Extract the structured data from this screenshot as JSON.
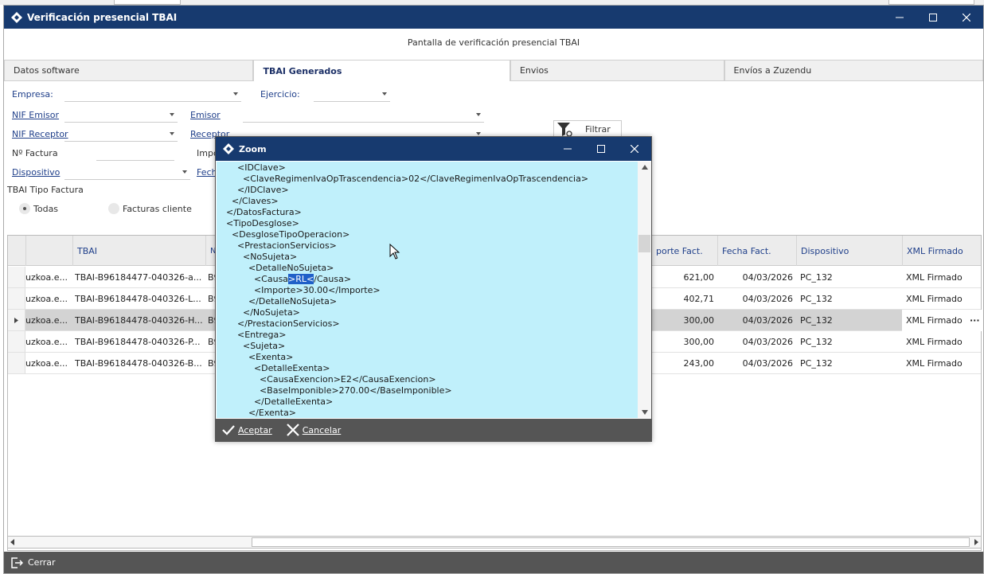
{
  "window": {
    "title": "Verificación presencial TBAI",
    "screen_title": "Pantalla de verificación presencial TBAI"
  },
  "tabs": [
    "Datos software",
    "TBAI Generados",
    "Envios",
    "Envíos a Zuzendu"
  ],
  "filters": {
    "empresa": "Empresa:",
    "ejercicio": "Ejercicio:",
    "nif_emisor": "NIF Emisor",
    "emisor": "Emisor",
    "nif_receptor": "NIF Receptor",
    "receptor": "Receptor",
    "n_factura": "Nº Factura",
    "importe_partial": "Impo",
    "dispositivo": "Dispositivo",
    "fecha_partial": "Fech",
    "filtrar": "Filtrar",
    "tipo_factura": "TBAI Tipo Factura",
    "radio_todas": "Todas",
    "radio_cliente": "Facturas cliente"
  },
  "grid": {
    "headers": [
      "TBAI",
      "NIF Em",
      "porte Fact.",
      "Fecha Fact.",
      "Dispositivo",
      "XML Firmado"
    ],
    "rows": [
      {
        "col1": "uzkoa.e...",
        "tbai": "TBAI-B96184477-040326-a...",
        "nif": "B9",
        "importe": "621,00",
        "fecha": "04/03/2026",
        "dispositivo": "PC_132",
        "xml": "XML Firmado"
      },
      {
        "col1": "uzkoa.e...",
        "tbai": "TBAI-B96184478-040326-L...",
        "nif": "B9",
        "importe": "402,71",
        "fecha": "04/03/2026",
        "dispositivo": "PC_132",
        "xml": "XML Firmado"
      },
      {
        "col1": "uzkoa.e...",
        "tbai": "TBAI-B96184478-040326-H...",
        "nif": "B9",
        "importe": "300,00",
        "fecha": "04/03/2026",
        "dispositivo": "PC_132",
        "xml": "XML Firmado"
      },
      {
        "col1": "uzkoa.e...",
        "tbai": "TBAI-B96184478-040326-P...",
        "nif": "B9",
        "importe": "300,00",
        "fecha": "04/03/2026",
        "dispositivo": "PC_132",
        "xml": "XML Firmado"
      },
      {
        "col1": "uzkoa.e...",
        "tbai": "TBAI-B96184478-040326-B...",
        "nif": "B9",
        "importe": "243,00",
        "fecha": "04/03/2026",
        "dispositivo": "PC_132",
        "xml": "XML Firmado"
      }
    ],
    "ellipsis": "···"
  },
  "bottom": {
    "cerrar": "Cerrar"
  },
  "zoom": {
    "title": "Zoom",
    "lines": [
      "      <IDClave>",
      "        <ClaveRegimenIvaOpTrascendencia>02</ClaveRegimenIvaOpTrascendencia>",
      "      </IDClave>",
      "    </Claves>",
      "  </DatosFactura>",
      "  <TipoDesglose>",
      "    <DesgloseTipoOperacion>",
      "      <PrestacionServicios>",
      "        <NoSujeta>",
      "          <DetalleNoSujeta>",
      "            <Causa",
      "            <Importe>30.00</Importe>",
      "          </DetalleNoSujeta>",
      "        </NoSujeta>",
      "      </PrestacionServicios>",
      "      <Entrega>",
      "        <Sujeta>",
      "          <Exenta>",
      "            <DetalleExenta>",
      "              <CausaExencion>E2</CausaExencion>",
      "              <BaseImponible>270.00</BaseImponible>",
      "            </DetalleExenta>",
      "          </Exenta>"
    ],
    "selected_text": ">RL<",
    "after_selected": "/Causa>",
    "aceptar": "Aceptar",
    "cancelar": "Cancelar"
  }
}
